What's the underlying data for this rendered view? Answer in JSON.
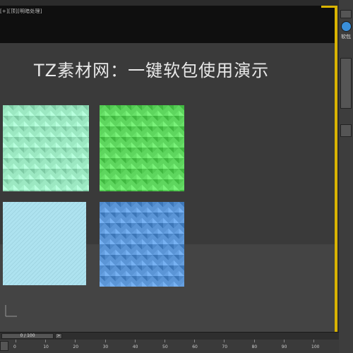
{
  "viewport": {
    "label": "[+][顶][明暗处理]",
    "title": "TZ素材网：一键软包使用演示"
  },
  "tiles": [
    {
      "name": "tile-mint-diamond",
      "color": "#9ce8c2",
      "pattern": "diamond"
    },
    {
      "name": "tile-green-diamond",
      "color": "#5ed65e",
      "pattern": "diamond"
    },
    {
      "name": "tile-lightblue-plain",
      "color": "#aee3f0",
      "pattern": "plain"
    },
    {
      "name": "tile-blue-diamond",
      "color": "#5b95d6",
      "pattern": "diamond"
    }
  ],
  "right_panel": {
    "text": "软包"
  },
  "timeline": {
    "slider_label": "0 / 100",
    "next_label": ">",
    "ruler_ticks": [
      "0",
      "10",
      "20",
      "30",
      "40",
      "50",
      "60",
      "70",
      "80",
      "90",
      "100"
    ]
  },
  "colors": {
    "viewport_bg": "#3a3a3a",
    "active_border": "#d9b300"
  }
}
